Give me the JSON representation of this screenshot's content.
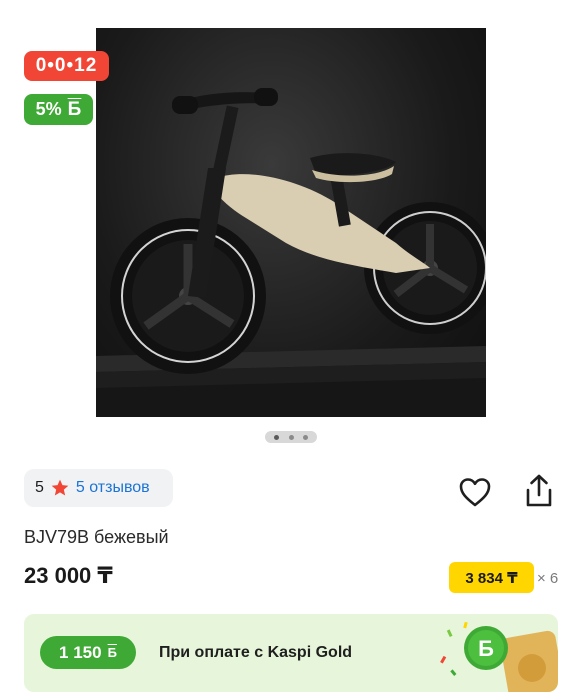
{
  "badges": {
    "timer": "0•0•12",
    "bonus_percent": "5%",
    "bonus_currency_icon": "Б"
  },
  "gallery": {
    "image_icon": "kids-balance-bike-image",
    "pages": 3,
    "active_page": 1
  },
  "rating": {
    "score": "5",
    "reviews_label": "5 отзывов",
    "star_color": "#f14635"
  },
  "actions": {
    "favorite_icon": "heart-icon",
    "share_icon": "share-icon"
  },
  "product": {
    "title": "BJV79B бежевый",
    "price": "23 000 ₸"
  },
  "installment": {
    "amount": "3 834 ₸",
    "months": "× 6"
  },
  "kaspi_gold": {
    "bonus_amount": "1 150",
    "bonus_icon": "Б",
    "text": "При оплате с Kaspi Gold"
  },
  "colors": {
    "timer_red": "#f14635",
    "bonus_green": "#3fa935",
    "installment_yellow": "#ffd600",
    "link_blue": "#1b74d6",
    "banner_bg": "#e7f5da"
  }
}
